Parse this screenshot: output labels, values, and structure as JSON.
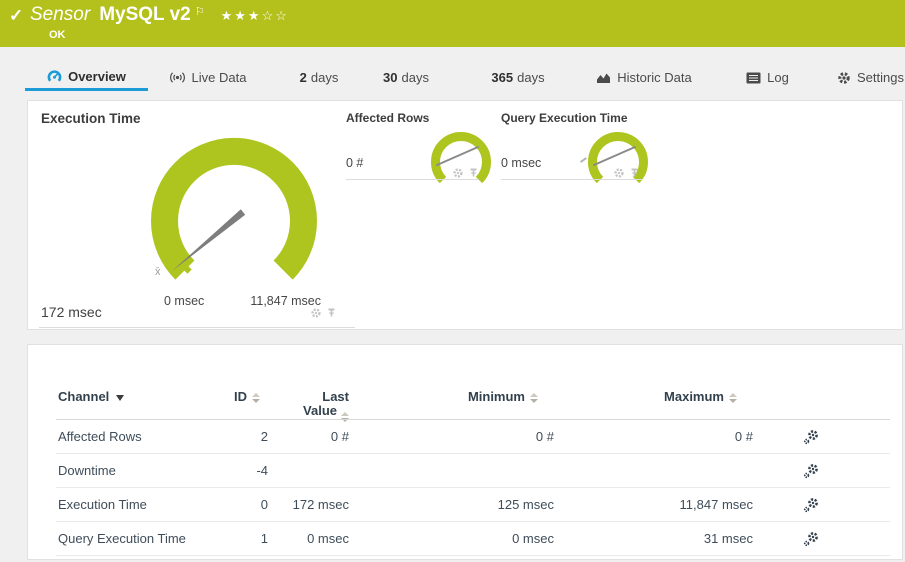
{
  "header": {
    "check_icon": "✓",
    "type_label": "Sensor",
    "sensor_name": "MySQL v2",
    "flag_icon": "⚐",
    "stars_filled": "★★★",
    "stars_empty": "☆☆",
    "status": "OK"
  },
  "tabs": [
    {
      "label": "Overview",
      "active": true
    },
    {
      "label": "Live Data"
    },
    {
      "num": "2",
      "label": "days"
    },
    {
      "num": "30",
      "label": "days"
    },
    {
      "num": "365",
      "label": "days"
    },
    {
      "label": "Historic Data"
    },
    {
      "label": "Log"
    },
    {
      "label": "Settings"
    }
  ],
  "gauges": {
    "execution_time": {
      "title": "Execution Time",
      "value": "172 msec",
      "min_label": "0 msec",
      "max_label": "11,847 msec",
      "avg_marker": "x̄"
    },
    "affected_rows": {
      "title": "Affected Rows",
      "value": "0 #"
    },
    "query_execution_time": {
      "title": "Query Execution Time",
      "value": "0 msec"
    }
  },
  "channel_table": {
    "headers": {
      "channel": "Channel",
      "id": "ID",
      "last_value": "Last Value",
      "minimum": "Minimum",
      "maximum": "Maximum"
    },
    "rows": [
      {
        "channel": "Affected Rows",
        "id": "2",
        "last_value": "0 #",
        "minimum": "0 #",
        "maximum": "0 #"
      },
      {
        "channel": "Downtime",
        "id": "-4",
        "last_value": "",
        "minimum": "",
        "maximum": ""
      },
      {
        "channel": "Execution Time",
        "id": "0",
        "last_value": "172 msec",
        "minimum": "125 msec",
        "maximum": "11,847 msec"
      },
      {
        "channel": "Query Execution Time",
        "id": "1",
        "last_value": "0 msec",
        "minimum": "0 msec",
        "maximum": "31 msec"
      }
    ]
  },
  "colors": {
    "ok_green": "#b4c11c",
    "gauge_green": "#adc51e",
    "accent_blue": "#1d9bd6"
  }
}
